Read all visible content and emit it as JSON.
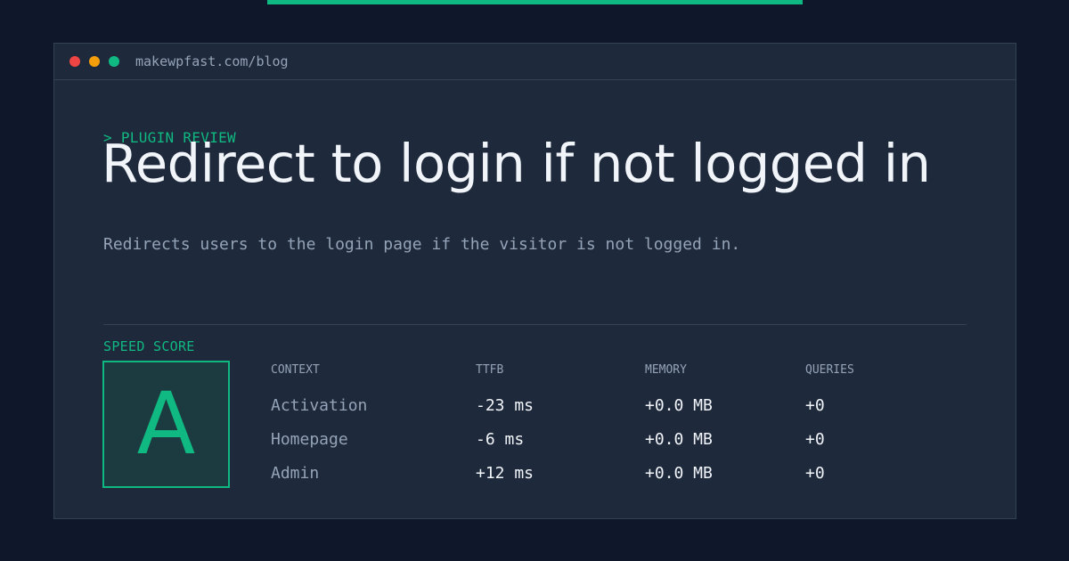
{
  "colors": {
    "background": "#0f172a",
    "panel": "#1e293b",
    "border": "#334155",
    "accent": "#10b981",
    "text_primary": "#f1f5f9",
    "text_muted": "#94a3b8",
    "dot_red": "#ef4444",
    "dot_yellow": "#f59e0b",
    "dot_green": "#10b981"
  },
  "window": {
    "url": "makewpfast.com/blog"
  },
  "header": {
    "kicker": "> PLUGIN REVIEW",
    "title": "Redirect to login if not logged in",
    "description": "Redirects users to the login page if the visitor is not logged in."
  },
  "speed": {
    "label": "SPEED SCORE",
    "grade": "A"
  },
  "table": {
    "headers": [
      "CONTEXT",
      "TTFB",
      "MEMORY",
      "QUERIES"
    ],
    "rows": [
      {
        "context": "Activation",
        "ttfb": "-23 ms",
        "memory": "+0.0 MB",
        "queries": "+0"
      },
      {
        "context": "Homepage",
        "ttfb": "-6 ms",
        "memory": "+0.0 MB",
        "queries": "+0"
      },
      {
        "context": "Admin",
        "ttfb": "+12 ms",
        "memory": "+0.0 MB",
        "queries": "+0"
      }
    ]
  }
}
